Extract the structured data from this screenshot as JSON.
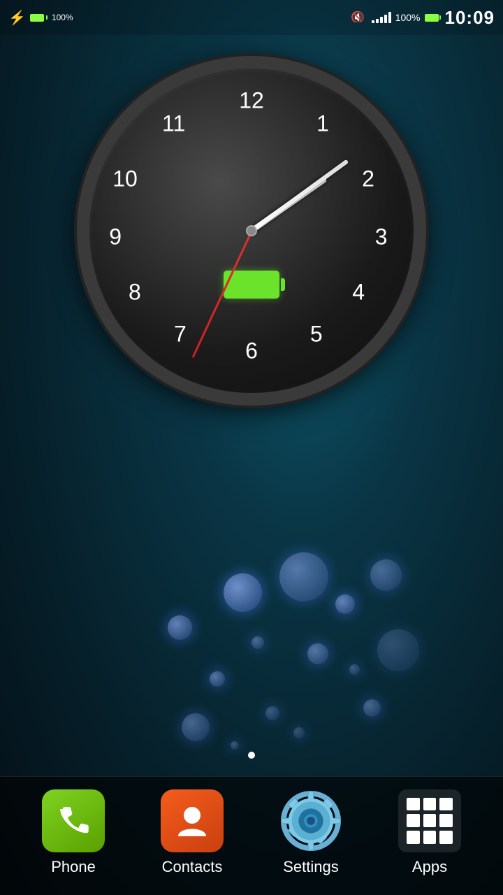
{
  "statusBar": {
    "time": "10:09",
    "batteryPercent": "100%",
    "signalBars": [
      4,
      6,
      8,
      10,
      12
    ],
    "muteIcon": "🔇"
  },
  "clock": {
    "numbers": [
      "12",
      "1",
      "2",
      "3",
      "4",
      "5",
      "6",
      "7",
      "8",
      "9",
      "10",
      "11"
    ],
    "hourAngle": 55,
    "minuteAngle": 54,
    "secondAngle": 205
  },
  "dock": {
    "items": [
      {
        "id": "phone",
        "label": "Phone"
      },
      {
        "id": "contacts",
        "label": "Contacts"
      },
      {
        "id": "settings",
        "label": "Settings"
      },
      {
        "id": "apps",
        "label": "Apps"
      }
    ]
  }
}
